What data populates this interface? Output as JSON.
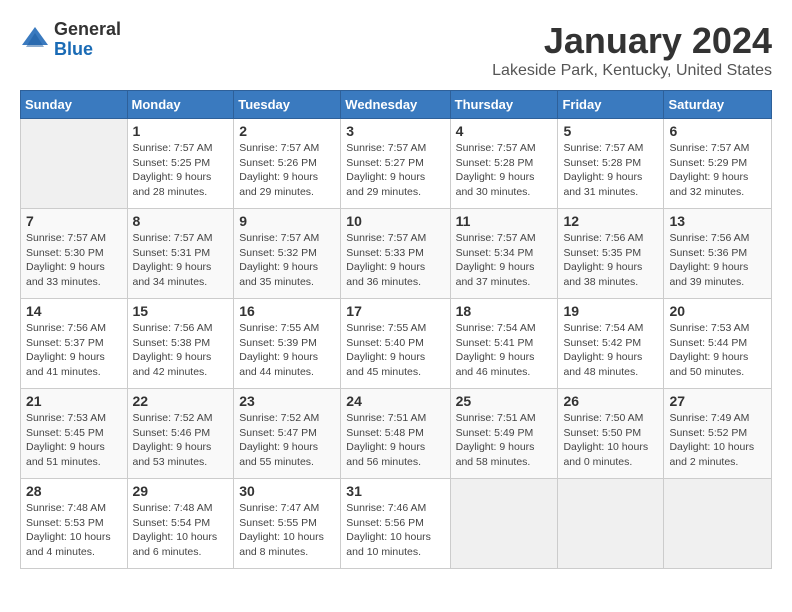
{
  "logo": {
    "general": "General",
    "blue": "Blue"
  },
  "title": "January 2024",
  "location": "Lakeside Park, Kentucky, United States",
  "headers": [
    "Sunday",
    "Monday",
    "Tuesday",
    "Wednesday",
    "Thursday",
    "Friday",
    "Saturday"
  ],
  "weeks": [
    [
      {
        "day": "",
        "sunrise": "",
        "sunset": "",
        "daylight": ""
      },
      {
        "day": "1",
        "sunrise": "Sunrise: 7:57 AM",
        "sunset": "Sunset: 5:25 PM",
        "daylight": "Daylight: 9 hours and 28 minutes."
      },
      {
        "day": "2",
        "sunrise": "Sunrise: 7:57 AM",
        "sunset": "Sunset: 5:26 PM",
        "daylight": "Daylight: 9 hours and 29 minutes."
      },
      {
        "day": "3",
        "sunrise": "Sunrise: 7:57 AM",
        "sunset": "Sunset: 5:27 PM",
        "daylight": "Daylight: 9 hours and 29 minutes."
      },
      {
        "day": "4",
        "sunrise": "Sunrise: 7:57 AM",
        "sunset": "Sunset: 5:28 PM",
        "daylight": "Daylight: 9 hours and 30 minutes."
      },
      {
        "day": "5",
        "sunrise": "Sunrise: 7:57 AM",
        "sunset": "Sunset: 5:28 PM",
        "daylight": "Daylight: 9 hours and 31 minutes."
      },
      {
        "day": "6",
        "sunrise": "Sunrise: 7:57 AM",
        "sunset": "Sunset: 5:29 PM",
        "daylight": "Daylight: 9 hours and 32 minutes."
      }
    ],
    [
      {
        "day": "7",
        "sunrise": "Sunrise: 7:57 AM",
        "sunset": "Sunset: 5:30 PM",
        "daylight": "Daylight: 9 hours and 33 minutes."
      },
      {
        "day": "8",
        "sunrise": "Sunrise: 7:57 AM",
        "sunset": "Sunset: 5:31 PM",
        "daylight": "Daylight: 9 hours and 34 minutes."
      },
      {
        "day": "9",
        "sunrise": "Sunrise: 7:57 AM",
        "sunset": "Sunset: 5:32 PM",
        "daylight": "Daylight: 9 hours and 35 minutes."
      },
      {
        "day": "10",
        "sunrise": "Sunrise: 7:57 AM",
        "sunset": "Sunset: 5:33 PM",
        "daylight": "Daylight: 9 hours and 36 minutes."
      },
      {
        "day": "11",
        "sunrise": "Sunrise: 7:57 AM",
        "sunset": "Sunset: 5:34 PM",
        "daylight": "Daylight: 9 hours and 37 minutes."
      },
      {
        "day": "12",
        "sunrise": "Sunrise: 7:56 AM",
        "sunset": "Sunset: 5:35 PM",
        "daylight": "Daylight: 9 hours and 38 minutes."
      },
      {
        "day": "13",
        "sunrise": "Sunrise: 7:56 AM",
        "sunset": "Sunset: 5:36 PM",
        "daylight": "Daylight: 9 hours and 39 minutes."
      }
    ],
    [
      {
        "day": "14",
        "sunrise": "Sunrise: 7:56 AM",
        "sunset": "Sunset: 5:37 PM",
        "daylight": "Daylight: 9 hours and 41 minutes."
      },
      {
        "day": "15",
        "sunrise": "Sunrise: 7:56 AM",
        "sunset": "Sunset: 5:38 PM",
        "daylight": "Daylight: 9 hours and 42 minutes."
      },
      {
        "day": "16",
        "sunrise": "Sunrise: 7:55 AM",
        "sunset": "Sunset: 5:39 PM",
        "daylight": "Daylight: 9 hours and 44 minutes."
      },
      {
        "day": "17",
        "sunrise": "Sunrise: 7:55 AM",
        "sunset": "Sunset: 5:40 PM",
        "daylight": "Daylight: 9 hours and 45 minutes."
      },
      {
        "day": "18",
        "sunrise": "Sunrise: 7:54 AM",
        "sunset": "Sunset: 5:41 PM",
        "daylight": "Daylight: 9 hours and 46 minutes."
      },
      {
        "day": "19",
        "sunrise": "Sunrise: 7:54 AM",
        "sunset": "Sunset: 5:42 PM",
        "daylight": "Daylight: 9 hours and 48 minutes."
      },
      {
        "day": "20",
        "sunrise": "Sunrise: 7:53 AM",
        "sunset": "Sunset: 5:44 PM",
        "daylight": "Daylight: 9 hours and 50 minutes."
      }
    ],
    [
      {
        "day": "21",
        "sunrise": "Sunrise: 7:53 AM",
        "sunset": "Sunset: 5:45 PM",
        "daylight": "Daylight: 9 hours and 51 minutes."
      },
      {
        "day": "22",
        "sunrise": "Sunrise: 7:52 AM",
        "sunset": "Sunset: 5:46 PM",
        "daylight": "Daylight: 9 hours and 53 minutes."
      },
      {
        "day": "23",
        "sunrise": "Sunrise: 7:52 AM",
        "sunset": "Sunset: 5:47 PM",
        "daylight": "Daylight: 9 hours and 55 minutes."
      },
      {
        "day": "24",
        "sunrise": "Sunrise: 7:51 AM",
        "sunset": "Sunset: 5:48 PM",
        "daylight": "Daylight: 9 hours and 56 minutes."
      },
      {
        "day": "25",
        "sunrise": "Sunrise: 7:51 AM",
        "sunset": "Sunset: 5:49 PM",
        "daylight": "Daylight: 9 hours and 58 minutes."
      },
      {
        "day": "26",
        "sunrise": "Sunrise: 7:50 AM",
        "sunset": "Sunset: 5:50 PM",
        "daylight": "Daylight: 10 hours and 0 minutes."
      },
      {
        "day": "27",
        "sunrise": "Sunrise: 7:49 AM",
        "sunset": "Sunset: 5:52 PM",
        "daylight": "Daylight: 10 hours and 2 minutes."
      }
    ],
    [
      {
        "day": "28",
        "sunrise": "Sunrise: 7:48 AM",
        "sunset": "Sunset: 5:53 PM",
        "daylight": "Daylight: 10 hours and 4 minutes."
      },
      {
        "day": "29",
        "sunrise": "Sunrise: 7:48 AM",
        "sunset": "Sunset: 5:54 PM",
        "daylight": "Daylight: 10 hours and 6 minutes."
      },
      {
        "day": "30",
        "sunrise": "Sunrise: 7:47 AM",
        "sunset": "Sunset: 5:55 PM",
        "daylight": "Daylight: 10 hours and 8 minutes."
      },
      {
        "day": "31",
        "sunrise": "Sunrise: 7:46 AM",
        "sunset": "Sunset: 5:56 PM",
        "daylight": "Daylight: 10 hours and 10 minutes."
      },
      {
        "day": "",
        "sunrise": "",
        "sunset": "",
        "daylight": ""
      },
      {
        "day": "",
        "sunrise": "",
        "sunset": "",
        "daylight": ""
      },
      {
        "day": "",
        "sunrise": "",
        "sunset": "",
        "daylight": ""
      }
    ]
  ]
}
